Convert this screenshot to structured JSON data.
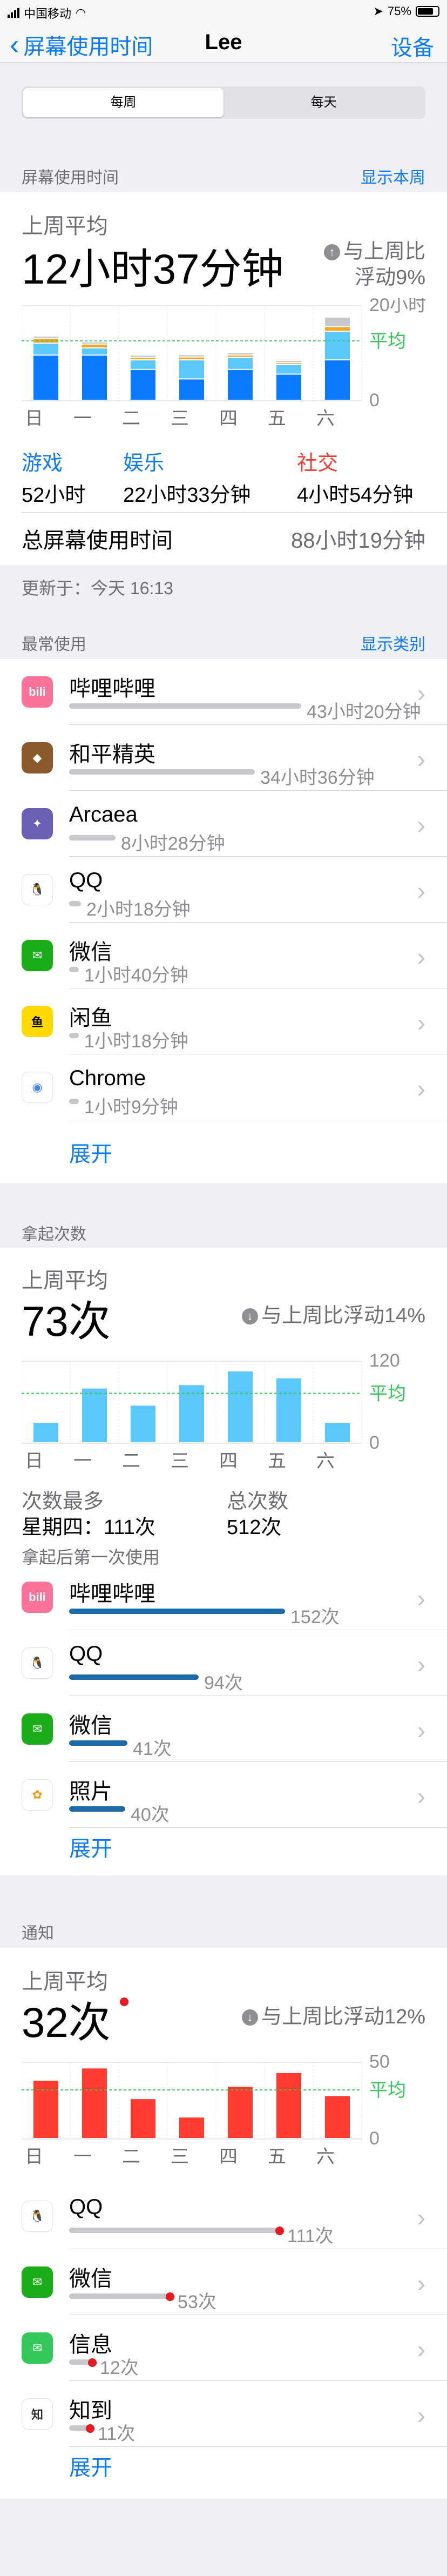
{
  "status_bar": {
    "carrier": "中国移动",
    "battery": "75%"
  },
  "nav": {
    "back_label": "屏幕使用时间",
    "title": "Lee",
    "right_label": "设备"
  },
  "segment": {
    "options": [
      "每周",
      "每天"
    ],
    "selected": "每周"
  },
  "screen_time": {
    "section_label": "屏幕使用时间",
    "section_link": "显示本周",
    "avg_label": "上周平均",
    "avg_value": "12小时37分钟",
    "delta_line1": "与上周比",
    "delta_line2": "浮动9%",
    "delta_direction": "up",
    "total_label": "总屏幕使用时间",
    "total_value": "88小时19分钟",
    "updated_label": "更新于：今天 16:13",
    "categories": [
      {
        "name": "游戏",
        "value": "52小时",
        "color": "#0a7aff"
      },
      {
        "name": "娱乐",
        "value": "22小时33分钟",
        "color": "#0a7aff"
      },
      {
        "name": "社交",
        "value": "4小时54分钟",
        "color": "#ff3b30"
      }
    ]
  },
  "chart_data": [
    {
      "type": "bar",
      "stacked": true,
      "categories": [
        "日",
        "一",
        "二",
        "三",
        "四",
        "五",
        "六"
      ],
      "series": [
        {
          "color": "#0a7aff",
          "values": [
            9.5,
            9.5,
            6.5,
            4.5,
            6.5,
            5.5,
            8.5
          ]
        },
        {
          "color": "#5ac8fa",
          "values": [
            2.5,
            1.5,
            2.0,
            4.0,
            2.5,
            2.0,
            6.0
          ]
        },
        {
          "color": "#f5a623",
          "values": [
            1.0,
            0.8,
            0.5,
            0.6,
            0.5,
            0.4,
            1.0
          ]
        },
        {
          "color": "#c7c7cc",
          "values": [
            0.5,
            0.5,
            0.5,
            0.5,
            0.5,
            0.5,
            2.0
          ]
        }
      ],
      "ylim": [
        0,
        20
      ],
      "yticks": [
        "0",
        "20小时"
      ],
      "average": 12.6,
      "average_label": "平均"
    },
    {
      "type": "bar",
      "categories": [
        "日",
        "一",
        "二",
        "三",
        "四",
        "五",
        "六"
      ],
      "series": [
        {
          "color": "#5ac8fa",
          "values": [
            30,
            80,
            55,
            85,
            105,
            95,
            30
          ]
        }
      ],
      "ylim": [
        0,
        120
      ],
      "yticks": [
        "0",
        "120"
      ],
      "average": 73,
      "average_label": "平均"
    },
    {
      "type": "bar",
      "categories": [
        "日",
        "一",
        "二",
        "三",
        "四",
        "五",
        "六"
      ],
      "series": [
        {
          "color": "#ff3b30",
          "values": [
            38,
            46,
            26,
            14,
            34,
            43,
            28
          ]
        }
      ],
      "ylim": [
        0,
        50
      ],
      "yticks": [
        "0",
        "50"
      ],
      "average": 32,
      "average_label": "平均"
    }
  ],
  "most_used": {
    "section_label": "最常使用",
    "section_link": "显示类别",
    "show_more": "展开",
    "items": [
      {
        "name": "哔哩哔哩",
        "value": "43小时20分钟",
        "icon": "bilibili-icon",
        "fraction": 1.0
      },
      {
        "name": "和平精英",
        "value": "34小时36分钟",
        "icon": "peace-elite-icon",
        "fraction": 0.8
      },
      {
        "name": "Arcaea",
        "value": "8小时28分钟",
        "icon": "arcaea-icon",
        "fraction": 0.2
      },
      {
        "name": "QQ",
        "value": "2小时18分钟",
        "icon": "qq-icon",
        "fraction": 0.05
      },
      {
        "name": "微信",
        "value": "1小时40分钟",
        "icon": "wechat-icon",
        "fraction": 0.04
      },
      {
        "name": "闲鱼",
        "value": "1小时18分钟",
        "icon": "xianyu-icon",
        "fraction": 0.03
      },
      {
        "name": "Chrome",
        "value": "1小时9分钟",
        "icon": "chrome-icon",
        "fraction": 0.03
      }
    ]
  },
  "pickups": {
    "section_label": "拿起次数",
    "avg_label": "上周平均",
    "avg_value": "73次",
    "delta": "与上周比浮动14%",
    "most_label": "次数最多",
    "most_value": "星期四：111次",
    "total_label": "总次数",
    "total_value": "512次",
    "first_used_label": "拿起后第一次使用",
    "show_more": "展开",
    "items": [
      {
        "name": "哔哩哔哩",
        "value": "152次",
        "icon": "bilibili-icon",
        "fraction": 1.0
      },
      {
        "name": "QQ",
        "value": "94次",
        "icon": "qq-icon",
        "fraction": 0.6
      },
      {
        "name": "微信",
        "value": "41次",
        "icon": "wechat-icon",
        "fraction": 0.27
      },
      {
        "name": "照片",
        "value": "40次",
        "icon": "photos-icon",
        "fraction": 0.26
      }
    ]
  },
  "notifications": {
    "section_label": "通知",
    "avg_label": "上周平均",
    "avg_value": "32次",
    "delta": "与上周比浮动12%",
    "show_more": "展开",
    "items": [
      {
        "name": "QQ",
        "value": "111次",
        "icon": "qq-icon",
        "fraction": 1.0
      },
      {
        "name": "微信",
        "value": "53次",
        "icon": "wechat-icon",
        "fraction": 0.48
      },
      {
        "name": "信息",
        "value": "12次",
        "icon": "messages-icon",
        "fraction": 0.11
      },
      {
        "name": "知到",
        "value": "11次",
        "icon": "zhidao-icon",
        "fraction": 0.1
      }
    ]
  }
}
